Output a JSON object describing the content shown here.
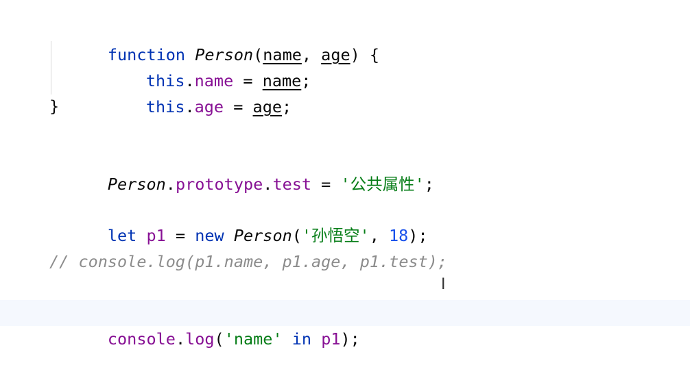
{
  "code": {
    "line1": {
      "kw": "function",
      "name": "Person",
      "open": "(",
      "p1": "name",
      "comma": ", ",
      "p2": "age",
      "close": ") {"
    },
    "line2": {
      "kw": "this",
      "dot": ".",
      "prop": "name",
      "eq": " = ",
      "val": "name",
      "end": ";"
    },
    "line3": {
      "kw": "this",
      "dot": ".",
      "prop": "age",
      "eq": " = ",
      "val": "age",
      "end": ";"
    },
    "line4": {
      "text": "}"
    },
    "line5": {
      "obj": "Person",
      "dot1": ".",
      "proto": "prototype",
      "dot2": ".",
      "prop": "test",
      "eq": " = ",
      "str": "'公共属性'",
      "end": ";"
    },
    "line6": {
      "kw": "let",
      "var": " p1",
      "eq": " = ",
      "new": "new",
      "space": " ",
      "cls": "Person",
      "open": "(",
      "str": "'孙悟空'",
      "comma": ", ",
      "num": "18",
      "end": ");"
    },
    "line7": {
      "comment": "// console.log(p1.name, p1.age, p1.test);"
    },
    "line8": {
      "obj": "console",
      "dot": ".",
      "method": "log",
      "open": "(",
      "str": "'name'",
      "space": " ",
      "kw": "in",
      "var": " p1",
      "end": ");"
    }
  },
  "colors": {
    "keyword": "#0033b3",
    "property": "#871094",
    "string": "#067d17",
    "number": "#1750eb",
    "comment": "#8c8c8c",
    "current_line": "#f5f8fe"
  },
  "icons": {
    "cursor": "text-cursor-icon"
  }
}
